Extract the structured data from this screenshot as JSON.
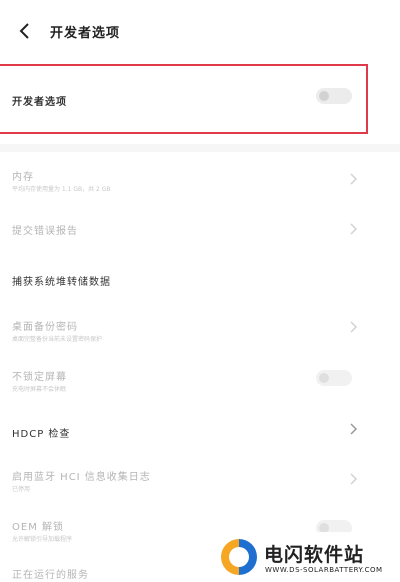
{
  "header": {
    "title": "开发者选项"
  },
  "main_toggle": {
    "label": "开发者选项",
    "on": false
  },
  "items": [
    {
      "label": "内存",
      "sub": "平均内存使用量为 1.1 GB，共 2 GB"
    },
    {
      "label": "提交错误报告"
    },
    {
      "label": "捕获系统堆转储数据"
    },
    {
      "label": "桌面备份密码",
      "sub": "桌面完整备份当前未设置密码保护"
    },
    {
      "label": "不锁定屏幕",
      "sub": "充电时屏幕不会休眠"
    },
    {
      "label": "HDCP 检查"
    },
    {
      "label": "启用蓝牙 HCI 信息收集日志",
      "sub": "已停用"
    },
    {
      "label": "OEM 解锁",
      "sub": "允许解锁引导加载程序"
    },
    {
      "label": "正在运行的服务"
    }
  ],
  "watermark": {
    "name": "电闪软件站",
    "url": "WWW.DS-SOLARBATTERY.COM"
  },
  "colors": {
    "highlight": "#e03a4a",
    "accent": "#1f6fd1",
    "brand_orange": "#f5a623"
  }
}
